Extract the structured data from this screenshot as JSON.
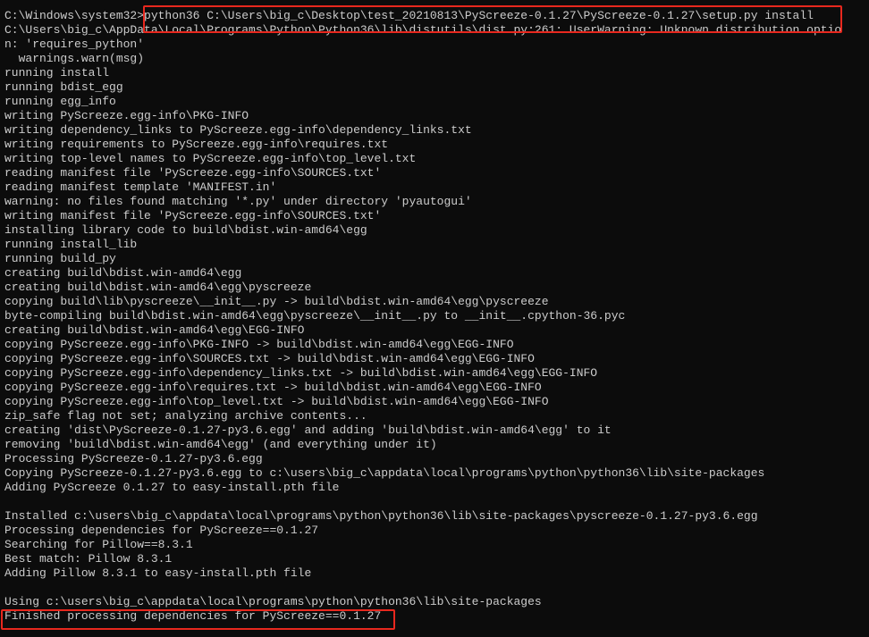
{
  "colors": {
    "background": "#0c0c0c",
    "foreground": "#cccccc",
    "annotation": "#e8281e"
  },
  "lines": [
    "C:\\Windows\\system32>python36 C:\\Users\\big_c\\Desktop\\test_20210813\\PyScreeze-0.1.27\\PyScreeze-0.1.27\\setup.py install",
    "C:\\Users\\big_c\\AppData\\Local\\Programs\\Python\\Python36\\lib\\distutils\\dist.py:261: UserWarning: Unknown distribution optio",
    "n: 'requires_python'",
    "  warnings.warn(msg)",
    "running install",
    "running bdist_egg",
    "running egg_info",
    "writing PyScreeze.egg-info\\PKG-INFO",
    "writing dependency_links to PyScreeze.egg-info\\dependency_links.txt",
    "writing requirements to PyScreeze.egg-info\\requires.txt",
    "writing top-level names to PyScreeze.egg-info\\top_level.txt",
    "reading manifest file 'PyScreeze.egg-info\\SOURCES.txt'",
    "reading manifest template 'MANIFEST.in'",
    "warning: no files found matching '*.py' under directory 'pyautogui'",
    "writing manifest file 'PyScreeze.egg-info\\SOURCES.txt'",
    "installing library code to build\\bdist.win-amd64\\egg",
    "running install_lib",
    "running build_py",
    "creating build\\bdist.win-amd64\\egg",
    "creating build\\bdist.win-amd64\\egg\\pyscreeze",
    "copying build\\lib\\pyscreeze\\__init__.py -> build\\bdist.win-amd64\\egg\\pyscreeze",
    "byte-compiling build\\bdist.win-amd64\\egg\\pyscreeze\\__init__.py to __init__.cpython-36.pyc",
    "creating build\\bdist.win-amd64\\egg\\EGG-INFO",
    "copying PyScreeze.egg-info\\PKG-INFO -> build\\bdist.win-amd64\\egg\\EGG-INFO",
    "copying PyScreeze.egg-info\\SOURCES.txt -> build\\bdist.win-amd64\\egg\\EGG-INFO",
    "copying PyScreeze.egg-info\\dependency_links.txt -> build\\bdist.win-amd64\\egg\\EGG-INFO",
    "copying PyScreeze.egg-info\\requires.txt -> build\\bdist.win-amd64\\egg\\EGG-INFO",
    "copying PyScreeze.egg-info\\top_level.txt -> build\\bdist.win-amd64\\egg\\EGG-INFO",
    "zip_safe flag not set; analyzing archive contents...",
    "creating 'dist\\PyScreeze-0.1.27-py3.6.egg' and adding 'build\\bdist.win-amd64\\egg' to it",
    "removing 'build\\bdist.win-amd64\\egg' (and everything under it)",
    "Processing PyScreeze-0.1.27-py3.6.egg",
    "Copying PyScreeze-0.1.27-py3.6.egg to c:\\users\\big_c\\appdata\\local\\programs\\python\\python36\\lib\\site-packages",
    "Adding PyScreeze 0.1.27 to easy-install.pth file",
    "",
    "Installed c:\\users\\big_c\\appdata\\local\\programs\\python\\python36\\lib\\site-packages\\pyscreeze-0.1.27-py3.6.egg",
    "Processing dependencies for PyScreeze==0.1.27",
    "Searching for Pillow==8.3.1",
    "Best match: Pillow 8.3.1",
    "Adding Pillow 8.3.1 to easy-install.pth file",
    "",
    "Using c:\\users\\big_c\\appdata\\local\\programs\\python\\python36\\lib\\site-packages",
    "Finished processing dependencies for PyScreeze==0.1.27"
  ]
}
